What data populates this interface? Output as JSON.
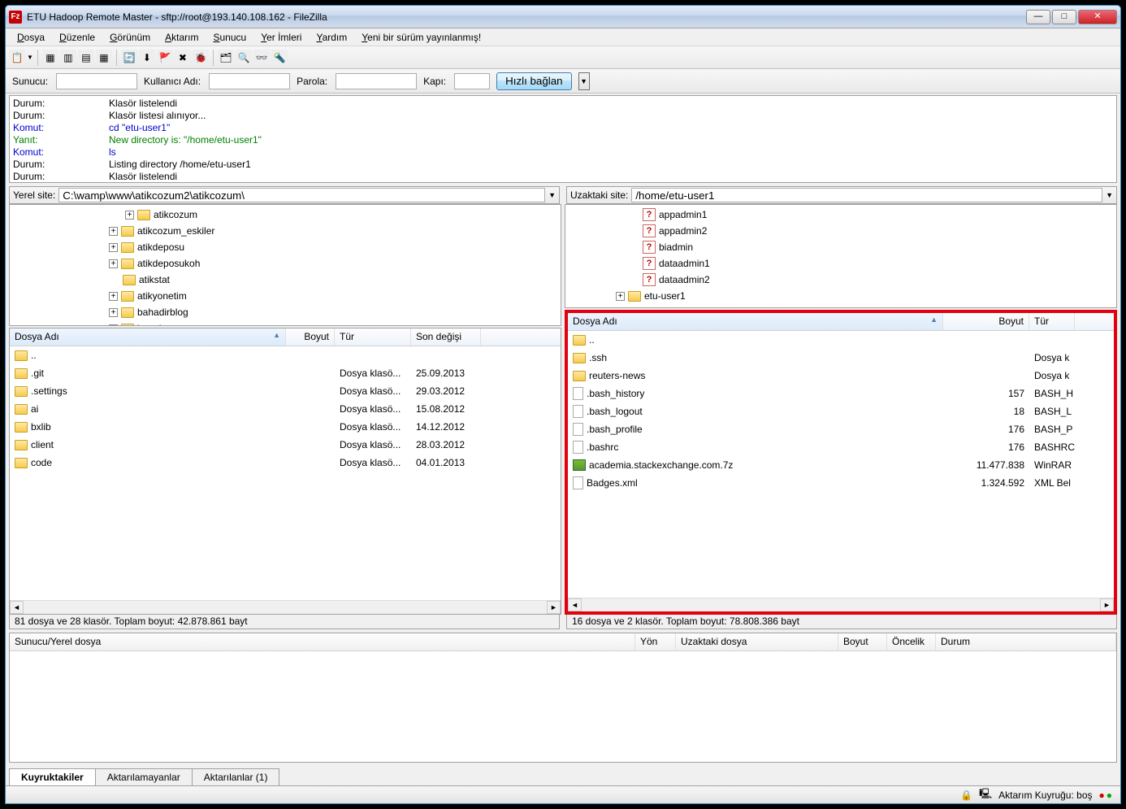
{
  "window": {
    "title": "ETU Hadoop Remote Master - sftp://root@193.140.108.162 - FileZilla"
  },
  "menubar": [
    "Dosya",
    "Düzenle",
    "Görünüm",
    "Aktarım",
    "Sunucu",
    "Yer İmleri",
    "Yardım",
    "Yeni bir sürüm yayınlanmış!"
  ],
  "connect": {
    "host_label": "Sunucu:",
    "user_label": "Kullanıcı Adı:",
    "pass_label": "Parola:",
    "port_label": "Kapı:",
    "quick_btn": "Hızlı bağlan"
  },
  "log": [
    {
      "cls": "",
      "k": "Durum:",
      "v": "Klasör listelendi"
    },
    {
      "cls": "",
      "k": "Durum:",
      "v": "Klasör listesi alınıyor..."
    },
    {
      "cls": "log-blue",
      "k": "Komut:",
      "v": "cd \"etu-user1\""
    },
    {
      "cls": "log-green",
      "k": "Yanıt:",
      "v": "New directory is: \"/home/etu-user1\""
    },
    {
      "cls": "log-blue",
      "k": "Komut:",
      "v": "ls"
    },
    {
      "cls": "",
      "k": "Durum:",
      "v": "Listing directory /home/etu-user1"
    },
    {
      "cls": "",
      "k": "Durum:",
      "v": "Klasör listelendi"
    }
  ],
  "local": {
    "site_label": "Yerel site:",
    "path": "C:\\wamp\\www\\atikcozum2\\atikcozum\\",
    "tree": [
      {
        "tw": "+",
        "name": "atikcozum",
        "indent": 140
      },
      {
        "tw": "+",
        "name": "atikcozum_eskiler",
        "indent": 120
      },
      {
        "tw": "+",
        "name": "atikdeposu",
        "indent": 120
      },
      {
        "tw": "+",
        "name": "atikdeposukoh",
        "indent": 120
      },
      {
        "tw": "",
        "name": "atikstat",
        "indent": 120
      },
      {
        "tw": "+",
        "name": "atikyonetim",
        "indent": 120
      },
      {
        "tw": "+",
        "name": "bahadirblog",
        "indent": 120
      },
      {
        "tw": "+",
        "name": "beegle",
        "indent": 120
      }
    ],
    "cols": {
      "name": "Dosya Adı",
      "size": "Boyut",
      "type": "Tür",
      "mod": "Son değişi"
    },
    "files": [
      {
        "icon": "folder",
        "name": "..",
        "size": "",
        "type": "",
        "mod": ""
      },
      {
        "icon": "folder",
        "name": ".git",
        "size": "",
        "type": "Dosya klasö...",
        "mod": "25.09.2013"
      },
      {
        "icon": "folder",
        "name": ".settings",
        "size": "",
        "type": "Dosya klasö...",
        "mod": "29.03.2012"
      },
      {
        "icon": "folder",
        "name": "ai",
        "size": "",
        "type": "Dosya klasö...",
        "mod": "15.08.2012"
      },
      {
        "icon": "folder",
        "name": "bxlib",
        "size": "",
        "type": "Dosya klasö...",
        "mod": "14.12.2012"
      },
      {
        "icon": "folder",
        "name": "client",
        "size": "",
        "type": "Dosya klasö...",
        "mod": "28.03.2012"
      },
      {
        "icon": "folder",
        "name": "code",
        "size": "",
        "type": "Dosya klasö...",
        "mod": "04.01.2013"
      }
    ],
    "status": "81 dosya ve 28 klasör. Toplam boyut: 42.878.861 bayt"
  },
  "remote": {
    "site_label": "Uzaktaki site:",
    "path": "/home/etu-user1",
    "tree": [
      {
        "tw": "",
        "icon": "?",
        "name": "appadmin1",
        "indent": 76
      },
      {
        "tw": "",
        "icon": "?",
        "name": "appadmin2",
        "indent": 76
      },
      {
        "tw": "",
        "icon": "?",
        "name": "biadmin",
        "indent": 76
      },
      {
        "tw": "",
        "icon": "?",
        "name": "dataadmin1",
        "indent": 76
      },
      {
        "tw": "",
        "icon": "?",
        "name": "dataadmin2",
        "indent": 76
      },
      {
        "tw": "+",
        "icon": "f",
        "name": "etu-user1",
        "indent": 60
      }
    ],
    "cols": {
      "name": "Dosya Adı",
      "size": "Boyut",
      "type": "Tür"
    },
    "files": [
      {
        "icon": "folder",
        "name": "..",
        "size": "",
        "type": ""
      },
      {
        "icon": "folder",
        "name": ".ssh",
        "size": "",
        "type": "Dosya k"
      },
      {
        "icon": "folder",
        "name": "reuters-news",
        "size": "",
        "type": "Dosya k"
      },
      {
        "icon": "file",
        "name": ".bash_history",
        "size": "157",
        "type": "BASH_H"
      },
      {
        "icon": "file",
        "name": ".bash_logout",
        "size": "18",
        "type": "BASH_L"
      },
      {
        "icon": "file",
        "name": ".bash_profile",
        "size": "176",
        "type": "BASH_P"
      },
      {
        "icon": "file",
        "name": ".bashrc",
        "size": "176",
        "type": "BASHRC"
      },
      {
        "icon": "archive",
        "name": "academia.stackexchange.com.7z",
        "size": "11.477.838",
        "type": "WinRAR"
      },
      {
        "icon": "file",
        "name": "Badges.xml",
        "size": "1.324.592",
        "type": "XML Bel"
      }
    ],
    "status": "16 dosya ve 2 klasör. Toplam boyut: 78.808.386 bayt"
  },
  "queue": {
    "cols": [
      "Sunucu/Yerel dosya",
      "Yön",
      "Uzaktaki dosya",
      "Boyut",
      "Öncelik",
      "Durum"
    ],
    "tabs": [
      "Kuyruktakiler",
      "Aktarılamayanlar",
      "Aktarılanlar (1)"
    ]
  },
  "statusbar": {
    "text": "Aktarım Kuyruğu: boş"
  }
}
